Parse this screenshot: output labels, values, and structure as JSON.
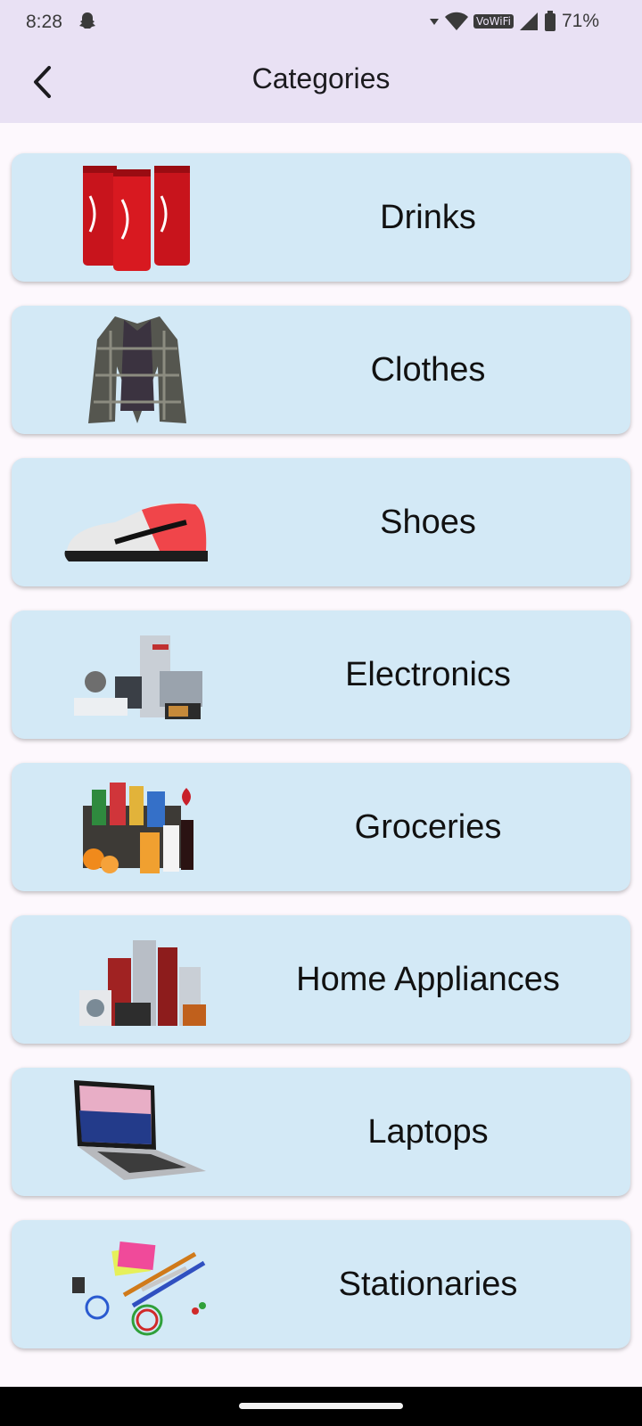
{
  "status_bar": {
    "time": "8:28",
    "network_label": "VoWiFi",
    "battery": "71%"
  },
  "app_bar": {
    "title": "Categories"
  },
  "categories": [
    {
      "label": "Drinks"
    },
    {
      "label": "Clothes"
    },
    {
      "label": "Shoes"
    },
    {
      "label": "Electronics"
    },
    {
      "label": "Groceries"
    },
    {
      "label": "Home Appliances"
    },
    {
      "label": "Laptops"
    },
    {
      "label": "Stationaries"
    }
  ],
  "colors": {
    "app_bar_bg": "#e9e1f4",
    "card_bg": "#d3e9f6",
    "page_bg": "#fdf8fd"
  }
}
